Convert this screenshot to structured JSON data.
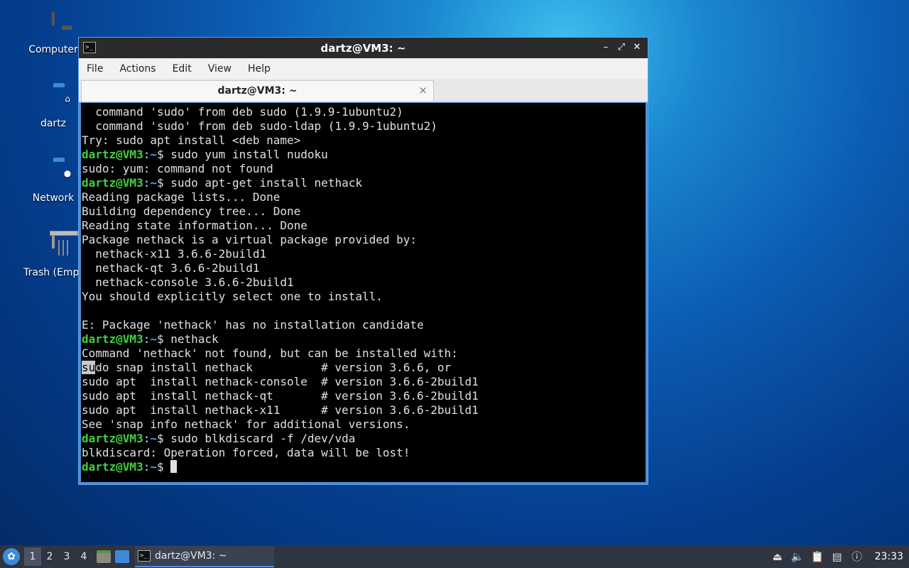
{
  "desktop": {
    "icons": [
      {
        "label": "Computer"
      },
      {
        "label": "dartz"
      },
      {
        "label": "Network"
      },
      {
        "label": "Trash (Empt"
      }
    ]
  },
  "window": {
    "title": "dartz@VM3: ~",
    "controls": {
      "minimize": "–",
      "maximize": "⤢",
      "close": "✕"
    },
    "menu": [
      "File",
      "Actions",
      "Edit",
      "View",
      "Help"
    ],
    "tab": {
      "title": "dartz@VM3: ~",
      "close": "×"
    }
  },
  "terminal": {
    "prompt_user": "dartz@VM3",
    "prompt_path": "~",
    "lines": [
      {
        "type": "out",
        "text": "  command 'sudo' from deb sudo (1.9.9-1ubuntu2)"
      },
      {
        "type": "out",
        "text": "  command 'sudo' from deb sudo-ldap (1.9.9-1ubuntu2)"
      },
      {
        "type": "out",
        "text": "Try: sudo apt install <deb name>"
      },
      {
        "type": "cmd",
        "text": "sudo yum install nudoku"
      },
      {
        "type": "out",
        "text": "sudo: yum: command not found"
      },
      {
        "type": "cmd",
        "text": "sudo apt-get install nethack"
      },
      {
        "type": "out",
        "text": "Reading package lists... Done"
      },
      {
        "type": "out",
        "text": "Building dependency tree... Done"
      },
      {
        "type": "out",
        "text": "Reading state information... Done"
      },
      {
        "type": "out",
        "text": "Package nethack is a virtual package provided by:"
      },
      {
        "type": "out",
        "text": "  nethack-x11 3.6.6-2build1"
      },
      {
        "type": "out",
        "text": "  nethack-qt 3.6.6-2build1"
      },
      {
        "type": "out",
        "text": "  nethack-console 3.6.6-2build1"
      },
      {
        "type": "out",
        "text": "You should explicitly select one to install."
      },
      {
        "type": "out",
        "text": ""
      },
      {
        "type": "out",
        "text": "E: Package 'nethack' has no installation candidate"
      },
      {
        "type": "cmd",
        "text": "nethack"
      },
      {
        "type": "out",
        "text": "Command 'nethack' not found, but can be installed with:"
      },
      {
        "type": "sel",
        "selected": "su",
        "text": "do snap install nethack          # version 3.6.6, or"
      },
      {
        "type": "out",
        "text": "sudo apt  install nethack-console  # version 3.6.6-2build1"
      },
      {
        "type": "out",
        "text": "sudo apt  install nethack-qt       # version 3.6.6-2build1"
      },
      {
        "type": "out",
        "text": "sudo apt  install nethack-x11      # version 3.6.6-2build1"
      },
      {
        "type": "out",
        "text": "See 'snap info nethack' for additional versions."
      },
      {
        "type": "cmd",
        "text": "sudo blkdiscard -f /dev/vda"
      },
      {
        "type": "out",
        "text": "blkdiscard: Operation forced, data will be lost!"
      },
      {
        "type": "cursor",
        "text": ""
      }
    ]
  },
  "taskbar": {
    "workspaces": [
      "1",
      "2",
      "3",
      "4"
    ],
    "active_workspace": "1",
    "task_title": "dartz@VM3: ~",
    "clock": "23:33"
  }
}
